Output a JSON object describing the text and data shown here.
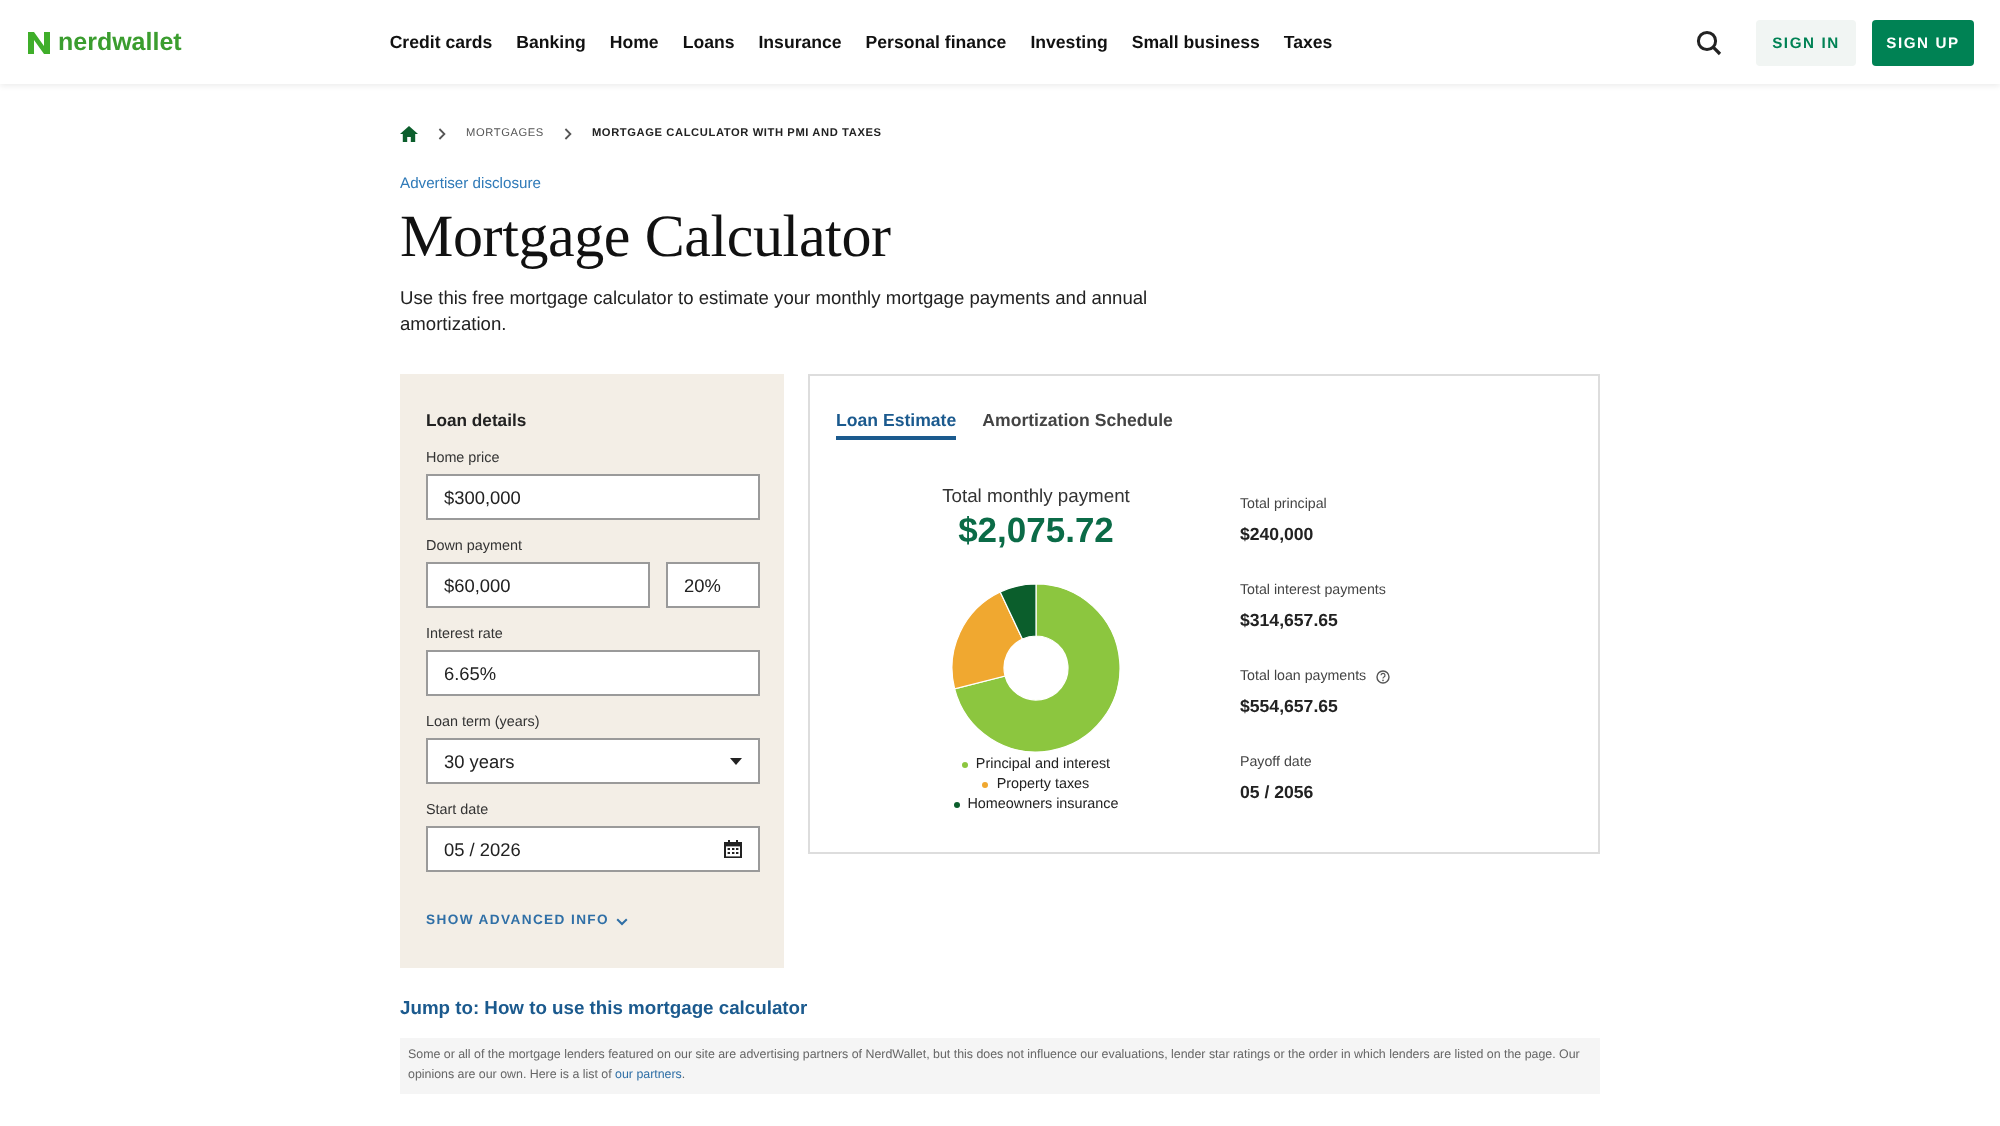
{
  "header": {
    "logo": "nerdwallet",
    "nav": [
      "Credit cards",
      "Banking",
      "Home",
      "Loans",
      "Insurance",
      "Personal finance",
      "Investing",
      "Small business",
      "Taxes"
    ],
    "sign_in": "SIGN IN",
    "sign_up": "SIGN UP"
  },
  "breadcrumb": [
    "MORTGAGES",
    "MORTGAGE CALCULATOR WITH PMI AND TAXES"
  ],
  "disclosure": "Advertiser disclosure",
  "title": "Mortgage Calculator",
  "intro": "Use this free mortgage calculator to estimate your monthly mortgage payments and annual amortization.",
  "loan_details": {
    "title": "Loan details",
    "fields": [
      {
        "label": "Home price",
        "kind": "text",
        "values": [
          "$300,000"
        ]
      },
      {
        "label": "Down payment",
        "kind": "pair",
        "values": [
          "$60,000",
          "20%"
        ]
      },
      {
        "label": "Interest rate",
        "kind": "text",
        "values": [
          "6.65%"
        ]
      },
      {
        "label": "Loan term (years)",
        "kind": "select",
        "values": [
          "30 years"
        ]
      },
      {
        "label": "Start date",
        "kind": "date",
        "values": [
          "05 / 2026"
        ]
      }
    ],
    "advanced": "SHOW ADVANCED INFO"
  },
  "results": {
    "tabs": [
      {
        "label": "Loan Estimate",
        "selected": true
      },
      {
        "label": "Amortization Schedule",
        "selected": false
      }
    ],
    "monthly_label": "Total monthly payment",
    "monthly_value": "$2,075.72",
    "legend": [
      {
        "label": "Principal and interest",
        "color": "#8cc63f"
      },
      {
        "label": "Property taxes",
        "color": "#f0a830"
      },
      {
        "label": "Homeowners insurance",
        "color": "#0b5e2c"
      }
    ],
    "stats": [
      {
        "label": "Total principal",
        "value": "$240,000",
        "info": false
      },
      {
        "label": "Total interest payments",
        "value": "$314,657.65",
        "info": false
      },
      {
        "label": "Total loan payments",
        "value": "$554,657.65",
        "info": true
      },
      {
        "label": "Payoff date",
        "value": "05 / 2056",
        "info": false
      }
    ]
  },
  "jump": "Jump to: How to use this mortgage calculator",
  "disclaimer": {
    "text": "Some or all of the mortgage lenders featured on our site are advertising partners of NerdWallet, but this does not influence our evaluations, lender star ratings or the order in which lenders are listed on the page. Our opinions are our own. Here is a list of ",
    "link": "our partners",
    "end": "."
  }
}
